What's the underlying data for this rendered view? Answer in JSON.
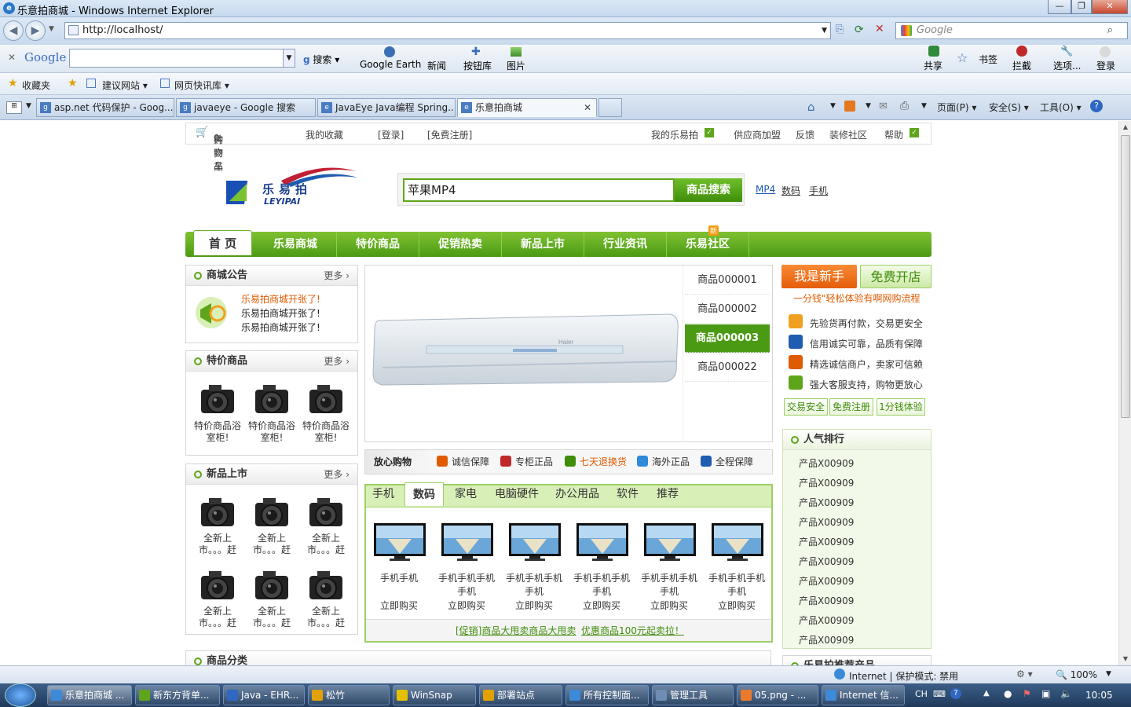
{
  "window": {
    "title": "乐意拍商城 - Windows Internet Explorer",
    "min": "—",
    "max": "❐",
    "close": "✕"
  },
  "address": {
    "url": "http://localhost/",
    "search_placeholder": "Google"
  },
  "google_bar": {
    "logo": "Google",
    "search": "搜索",
    "earth": "Google Earth",
    "news": "新闻",
    "buttons": "按钮库",
    "images": "图片",
    "share": "共享",
    "bookmarks": "书签",
    "block": "拦截",
    "options": "选项...",
    "login": "登录"
  },
  "favorites": {
    "label": "收藏夹",
    "suggest": "建议网站",
    "webslice": "网页快讯库"
  },
  "tabs": [
    "asp.net 代码保护 - Goog...",
    "javaeye - Google 搜索",
    "JavaEye Java编程 Spring...",
    "乐意拍商城"
  ],
  "cmdbar": {
    "page": "页面(P)",
    "safety": "安全(S)",
    "tools": "工具(O)"
  },
  "site": {
    "topbar": {
      "cart": "购物车",
      "cart_count": "0",
      "cart_suffix": "种商品",
      "favorites": "我的收藏",
      "login": "[登录]",
      "register": "[免费注册]",
      "my": "我的乐易拍",
      "supplier": "供应商加盟",
      "feedback": "反馈",
      "community": "装修社区",
      "help": "帮助"
    },
    "logo": {
      "cn": "乐易拍",
      "en": "LEYIPAI"
    },
    "search": {
      "value": "苹果MP4",
      "button": "商品搜索",
      "hot": [
        "MP4",
        "数码",
        "手机"
      ]
    },
    "nav": {
      "home": "首 页",
      "items": [
        "乐易商城",
        "特价商品",
        "促销热卖",
        "新品上市",
        "行业资讯",
        "乐易社区"
      ],
      "new_badge": "新"
    },
    "notice": {
      "title": "商城公告",
      "more": "更多 ›",
      "items": [
        "乐易拍商城开张了!",
        "乐易拍商城开张了!",
        "乐易拍商城开张了!"
      ]
    },
    "special": {
      "title": "特价商品",
      "more": "更多 ›",
      "items": [
        "特价商品浴室柜!",
        "特价商品浴室柜!",
        "特价商品浴室柜!"
      ]
    },
    "newp": {
      "title": "新品上市",
      "more": "更多 ›",
      "items": [
        "全新上市。。。赶",
        "全新上市。。。赶",
        "全新上市。。。赶",
        "全新上市。。。赶",
        "全新上市。。。赶",
        "全新上市。。。赶"
      ]
    },
    "category": {
      "title": "商品分类"
    },
    "slider": {
      "tabs": [
        "商品000001",
        "商品000002",
        "商品000003",
        "商品000022"
      ],
      "active": 2,
      "brand": "Haier"
    },
    "guarantee": {
      "label": "放心购物",
      "items": [
        "诚信保障",
        "专柜正品",
        "七天退换货",
        "海外正品",
        "全程保障"
      ]
    },
    "ptabs": {
      "items": [
        "手机",
        "数码",
        "家电",
        "电脑硬件",
        "办公用品",
        "软件",
        "推荐"
      ],
      "active": 1
    },
    "products": [
      {
        "name": "手机手机",
        "buy": "立即购买"
      },
      {
        "name": "手机手机手机手机",
        "buy": "立即购买"
      },
      {
        "name": "手机手机手机手机",
        "buy": "立即购买"
      },
      {
        "name": "手机手机手机手机",
        "buy": "立即购买"
      },
      {
        "name": "手机手机手机手机",
        "buy": "立即购买"
      },
      {
        "name": "手机手机手机手机",
        "buy": "立即购买"
      }
    ],
    "promo": {
      "a": "[促销]商品大甩卖商品大甩卖",
      "b": "优惠商品100元起卖拉！"
    },
    "newbie": {
      "btn1": "我是新手",
      "btn2": "免费开店",
      "slogan": "一分钱\"轻松体验有啊网购流程",
      "features": [
        "先验货再付款，交易更安全",
        "信用诚实可靠，品质有保障",
        "精选诚信商户，卖家可信赖",
        "强大客服支持，购物更放心"
      ],
      "links": [
        "交易安全",
        "免费注册",
        "1分钱体验"
      ]
    },
    "ranking": {
      "title": "人气排行",
      "items": [
        "产品X00909",
        "产品X00909",
        "产品X00909",
        "产品X00909",
        "产品X00909",
        "产品X00909",
        "产品X00909",
        "产品X00909",
        "产品X00909",
        "产品X00909"
      ],
      "next": "乐易拍推荐产品"
    }
  },
  "status": {
    "zone": "Internet | 保护模式: 禁用",
    "zoom": "100%"
  },
  "taskbar": {
    "items": [
      "乐意拍商城 ...",
      "新东方背单...",
      "Java - EHR...",
      "松竹",
      "WinSnap",
      "部署站点",
      "所有控制面...",
      "管理工具",
      "05.png - ...",
      "Internet 信..."
    ],
    "lang": "CH",
    "time": "10:05"
  }
}
